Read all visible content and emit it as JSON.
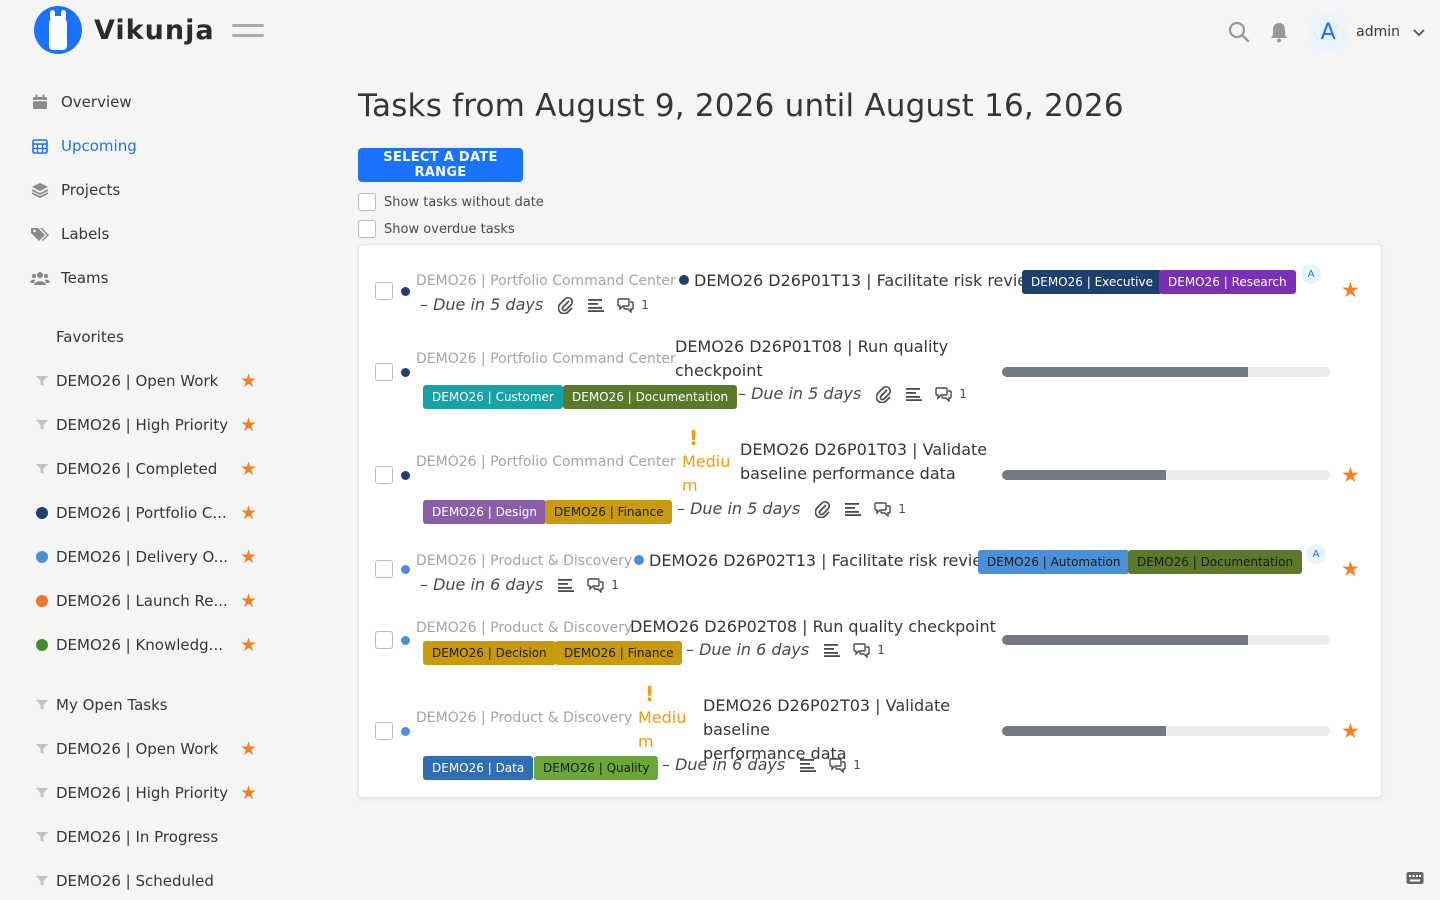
{
  "app": {
    "name": "Vikunja"
  },
  "user": {
    "initial": "A",
    "name": "admin"
  },
  "nav": [
    {
      "label": "Overview",
      "icon": "calendar-icon"
    },
    {
      "label": "Upcoming",
      "icon": "calendar-grid-icon",
      "active": true
    },
    {
      "label": "Projects",
      "icon": "layers-icon"
    },
    {
      "label": "Labels",
      "icon": "tags-icon"
    },
    {
      "label": "Teams",
      "icon": "users-icon"
    }
  ],
  "sidebar": {
    "favorites_title": "Favorites",
    "favorites": [
      {
        "label": "DEMO26 | Open Work",
        "type": "filter",
        "starred": true
      },
      {
        "label": "DEMO26 | High Priority",
        "type": "filter",
        "starred": true
      },
      {
        "label": "DEMO26 | Completed",
        "type": "filter",
        "starred": true
      },
      {
        "label": "DEMO26 | Portfolio C...",
        "type": "project",
        "color": "#1f3f6e",
        "starred": true
      },
      {
        "label": "DEMO26 | Delivery O...",
        "type": "project",
        "color": "#4a90d9",
        "starred": true
      },
      {
        "label": "DEMO26 | Launch Re...",
        "type": "project",
        "color": "#f0792b",
        "starred": true
      },
      {
        "label": "DEMO26 | Knowledg...",
        "type": "project",
        "color": "#4a8a2f",
        "starred": true
      }
    ],
    "filters": [
      {
        "label": "My Open Tasks",
        "starred": false
      },
      {
        "label": "DEMO26 | Open Work",
        "starred": true
      },
      {
        "label": "DEMO26 | High Priority",
        "starred": true
      },
      {
        "label": "DEMO26 | In Progress",
        "starred": false
      },
      {
        "label": "DEMO26 | Scheduled",
        "starred": false
      }
    ]
  },
  "main": {
    "title": "Tasks from August 9, 2026 until August 16, 2026",
    "select_range_label": "SELECT A DATE RANGE",
    "show_without_date": "Show tasks without date",
    "show_overdue": "Show overdue tasks"
  },
  "tasks": [
    {
      "project": "DEMO26 | Portfolio Command Center",
      "project_color": "#1f3f6e",
      "title": "DEMO26 D26P01T13 | Facilitate risk review",
      "labels": [
        {
          "text": "DEMO26 | Executive",
          "color": "#1f3f6e"
        },
        {
          "text": "DEMO26 | Research",
          "color": "#7b2fb5"
        }
      ],
      "due": "– Due in 5 days",
      "attachment": true,
      "comments": "1",
      "assignee": "A",
      "starred": true
    },
    {
      "project": "DEMO26 | Portfolio Command Center",
      "project_color": "#1f3f6e",
      "title_line1": "DEMO26 D26P01T08 | Run quality",
      "title_line2": "checkpoint",
      "labels": [
        {
          "text": "DEMO26 | Customer",
          "color": "#16a3a8"
        },
        {
          "text": "DEMO26 | Documentation",
          "color": "#5a7a2a"
        }
      ],
      "due": "– Due in 5 days",
      "attachment": true,
      "comments": "1",
      "progress": 0.75,
      "starred": false
    },
    {
      "project": "DEMO26 | Portfolio Command Center",
      "project_color": "#1f3f6e",
      "priority_line1": "Mediu",
      "priority_line2": "m",
      "title_line1": "DEMO26 D26P01T03 | Validate",
      "title_line2": "baseline performance data",
      "labels": [
        {
          "text": "DEMO26 | Design",
          "color": "#8a5fa8"
        },
        {
          "text": "DEMO26 | Finance",
          "color": "#c89a0c"
        }
      ],
      "due": "– Due in 5 days",
      "attachment": true,
      "comments": "1",
      "progress": 0.5,
      "starred": true
    },
    {
      "project": "DEMO26 | Product & Discovery",
      "project_color": "#4a90d9",
      "title": "DEMO26 D26P02T13 | Facilitate risk review",
      "labels": [
        {
          "text": "DEMO26 | Automation",
          "color": "#4a90d9"
        },
        {
          "text": "DEMO26 | Documentation",
          "color": "#5a7a2a"
        }
      ],
      "due": "– Due in 6 days",
      "comments": "1",
      "assignee": "A",
      "starred": true
    },
    {
      "project": "DEMO26 | Product & Discovery",
      "project_color": "#4a90d9",
      "title": "DEMO26 D26P02T08 | Run quality checkpoint",
      "labels": [
        {
          "text": "DEMO26 | Decision",
          "color": "#c89a0c"
        },
        {
          "text": "DEMO26 | Finance",
          "color": "#c89a0c"
        }
      ],
      "due": "– Due in 6 days",
      "comments": "1",
      "progress": 0.75,
      "starred": false
    },
    {
      "project": "DEMO26 | Product & Discovery",
      "project_color": "#4a90d9",
      "priority_line1": "Mediu",
      "priority_line2": "m",
      "title_line1": "DEMO26 D26P02T03 | Validate baseline",
      "title_line2": "performance data",
      "labels": [
        {
          "text": "DEMO26 | Data",
          "color": "#2f6db5"
        },
        {
          "text": "DEMO26 | Quality",
          "color": "#6aa83a"
        }
      ],
      "due": "– Due in 6 days",
      "comments": "1",
      "progress": 0.5,
      "starred": true
    }
  ],
  "colors": {
    "accent": "#1973ff",
    "star": "#f6821f",
    "priority": "#f29d0c"
  }
}
